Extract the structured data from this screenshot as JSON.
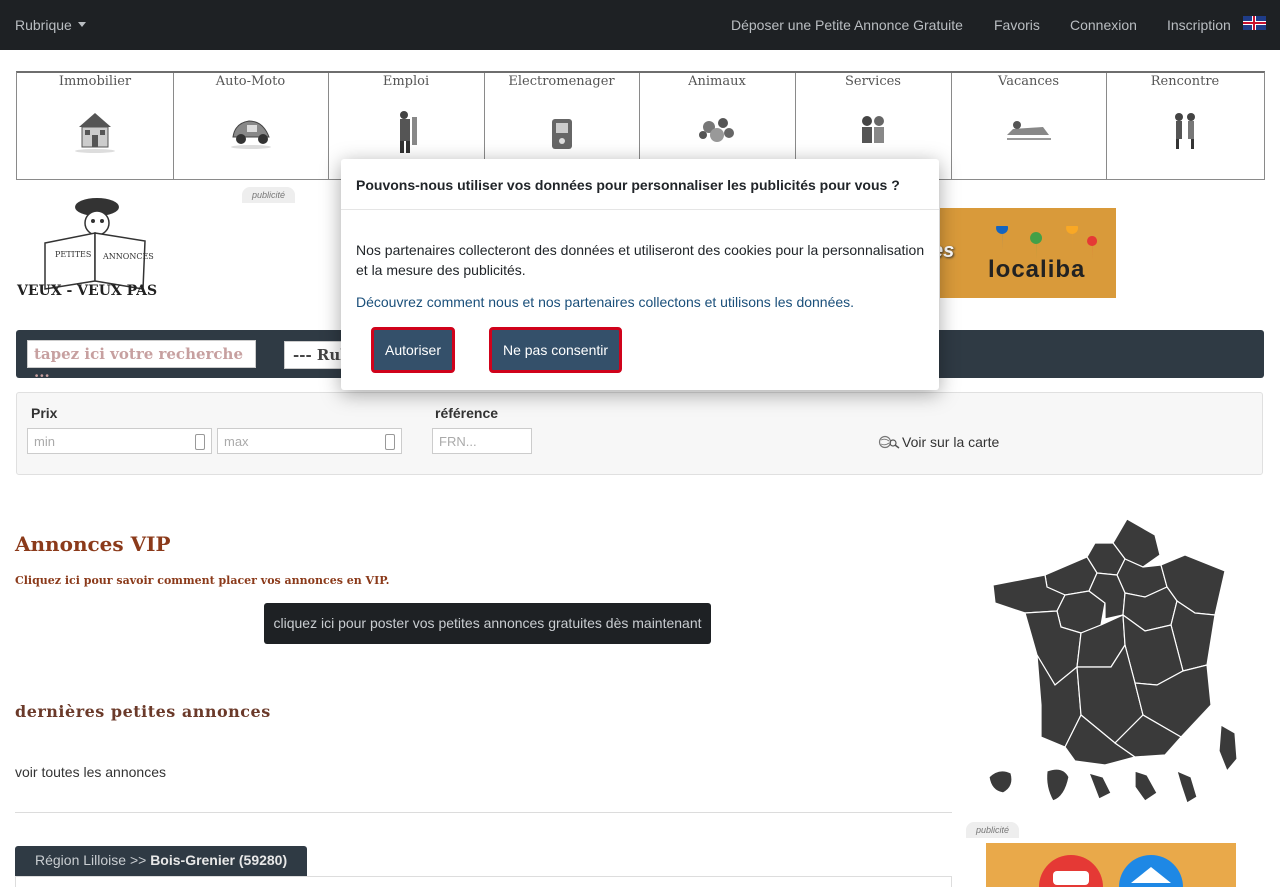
{
  "navbar": {
    "rubrique": "Rubrique",
    "links": [
      "Déposer une Petite Annonce Gratuite",
      "Favoris",
      "Connexion",
      "Inscription"
    ],
    "language_icon": "uk-flag-icon"
  },
  "categories": [
    {
      "label": "Immobilier",
      "icon": "house-icon"
    },
    {
      "label": "Auto-Moto",
      "icon": "car-icon"
    },
    {
      "label": "Emploi",
      "icon": "worker-icon"
    },
    {
      "label": "Electromenager",
      "icon": "appliance-icon"
    },
    {
      "label": "Animaux",
      "icon": "animals-icon"
    },
    {
      "label": "Services",
      "icon": "services-icon"
    },
    {
      "label": "Vacances",
      "icon": "vacation-icon"
    },
    {
      "label": "Rencontre",
      "icon": "couple-icon"
    }
  ],
  "logo": {
    "text": "VEUX - VEUX PAS",
    "paper_text": "PETITES ANNONCES"
  },
  "ads": {
    "tag": "publicité",
    "banner_brand": "localiba",
    "banner_fragment": "es"
  },
  "search": {
    "placeholder": "tapez ici votre recherche ...",
    "rubrique_value": "--- Rubrique"
  },
  "filters": {
    "prix_label": "Prix",
    "min_placeholder": "min",
    "max_placeholder": "max",
    "reference_label": "référence",
    "reference_placeholder": "FRN...",
    "map_link": "Voir sur la carte"
  },
  "main": {
    "vip_title": "Annonces VIP",
    "vip_subtitle": "Cliquez ici pour savoir comment placer vos annonces en VIP.",
    "post_button": "cliquez ici pour poster vos petites annonces gratuites dès maintenant",
    "last_title": "dernières petites annonces",
    "see_all": "voir toutes les annonces",
    "region_prefix": "Région Lilloise >> ",
    "region_place": "Bois-Grenier (59280)"
  },
  "modal": {
    "title": "Pouvons-nous utiliser vos données pour personnaliser les publicités pour vous ?",
    "text": "Nos partenaires collecteront des données et utiliseront des cookies pour la personnalisation et la mesure des publicités.",
    "link": "Découvrez comment nous et nos partenaires collectons et utilisons les données.",
    "allow_button": "Autoriser",
    "deny_button": "Ne pas consentir"
  },
  "colors": {
    "navbar": "#1e2124",
    "accent": "#8b3a1a",
    "button_border": "#d0021b",
    "button_bg": "#34506a"
  }
}
